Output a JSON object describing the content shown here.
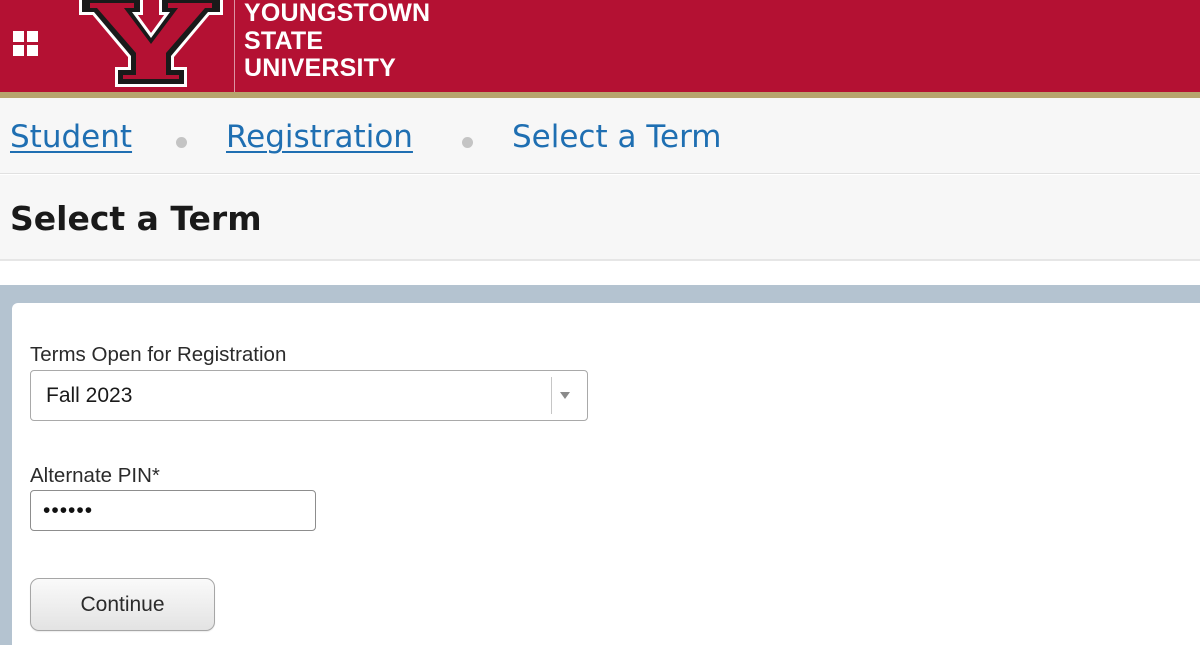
{
  "header": {
    "apps_icon": "grid-icon",
    "logo_icon": "ysu-y-logo",
    "university_name": [
      "YOUNGSTOWN",
      "STATE",
      "UNIVERSITY"
    ],
    "colors": {
      "brand_red": "#b41133",
      "accent_gold": "#b7a46d"
    }
  },
  "breadcrumb": {
    "items": [
      {
        "label": "Student",
        "link": true
      },
      {
        "label": "Registration",
        "link": true
      },
      {
        "label": "Select a Term",
        "link": false
      }
    ],
    "link_color": "#1f6fb2"
  },
  "page": {
    "title": "Select a Term"
  },
  "form": {
    "term_label": "Terms Open for Registration",
    "term_value": "Fall 2023",
    "pin_label": "Alternate PIN*",
    "pin_value": "••••••",
    "continue_label": "Continue"
  }
}
